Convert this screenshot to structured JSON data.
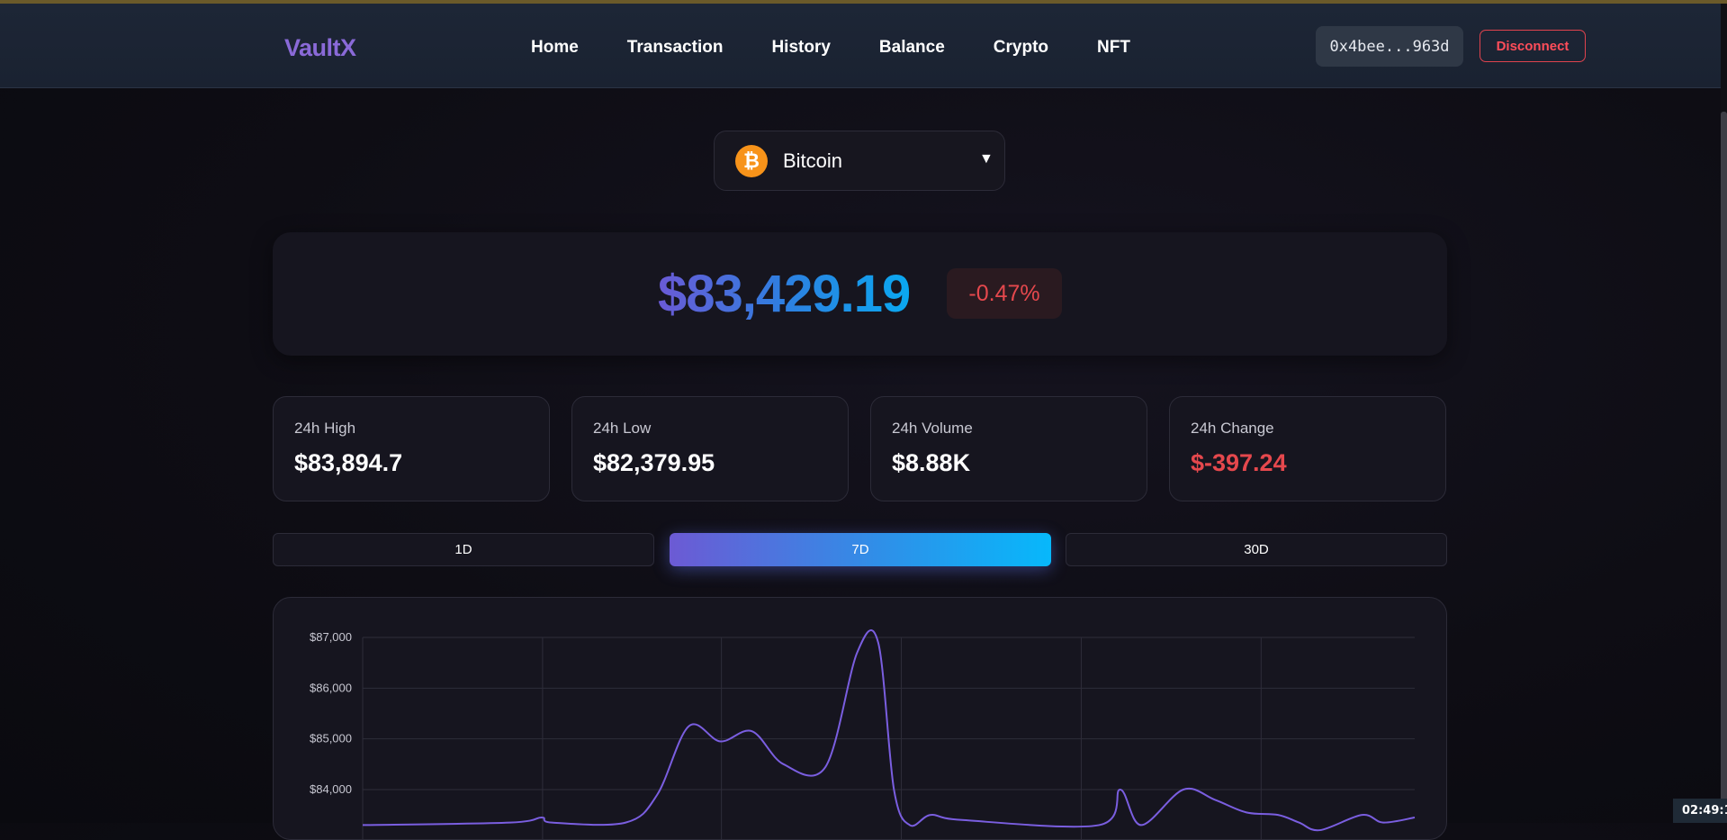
{
  "header": {
    "logo": "VaultX",
    "nav": [
      "Home",
      "Transaction",
      "History",
      "Balance",
      "Crypto",
      "NFT"
    ],
    "wallet_address": "0x4bee...963d",
    "disconnect_label": "Disconnect"
  },
  "coin_selector": {
    "icon": "bitcoin-icon",
    "icon_glyph": "₿",
    "selected": "Bitcoin",
    "caret": "▼"
  },
  "price": {
    "value": "$83,429.19",
    "change_percent": "-0.47%"
  },
  "stats": [
    {
      "label": "24h High",
      "value": "$83,894.7"
    },
    {
      "label": "24h Low",
      "value": "$82,379.95"
    },
    {
      "label": "24h Volume",
      "value": "$8.88K"
    },
    {
      "label": "24h Change",
      "value": "$-397.24"
    }
  ],
  "ranges": {
    "options": [
      "1D",
      "7D",
      "30D"
    ],
    "selected": "7D"
  },
  "colors": {
    "accent_purple": "#6c5ad4",
    "accent_blue": "#07b8fb",
    "negative": "#e5484d",
    "line": "#7a5ee0"
  },
  "chart_data": {
    "type": "line",
    "y_ticks": [
      "$87,000",
      "$86,000",
      "$85,000",
      "$84,000"
    ],
    "ylim_visible": [
      83400,
      87000
    ],
    "grid": true,
    "series": [
      {
        "values": [
          [
            0.0,
            83300
          ],
          [
            0.14,
            83350
          ],
          [
            0.17,
            83450
          ],
          [
            0.18,
            83350
          ],
          [
            0.25,
            83350
          ],
          [
            0.28,
            83900
          ],
          [
            0.31,
            85250
          ],
          [
            0.34,
            84950
          ],
          [
            0.37,
            85150
          ],
          [
            0.4,
            84500
          ],
          [
            0.44,
            84450
          ],
          [
            0.47,
            86700
          ],
          [
            0.49,
            86900
          ],
          [
            0.505,
            84000
          ],
          [
            0.52,
            83300
          ],
          [
            0.54,
            83500
          ],
          [
            0.57,
            83400
          ],
          [
            0.7,
            83300
          ],
          [
            0.72,
            84000
          ],
          [
            0.74,
            83300
          ],
          [
            0.78,
            84000
          ],
          [
            0.81,
            83800
          ],
          [
            0.84,
            83550
          ],
          [
            0.87,
            83500
          ],
          [
            0.89,
            83350
          ],
          [
            0.91,
            83200
          ],
          [
            0.95,
            83500
          ],
          [
            0.97,
            83350
          ],
          [
            1.0,
            83450
          ]
        ]
      }
    ]
  },
  "taskbar_clock": "02:49:1"
}
